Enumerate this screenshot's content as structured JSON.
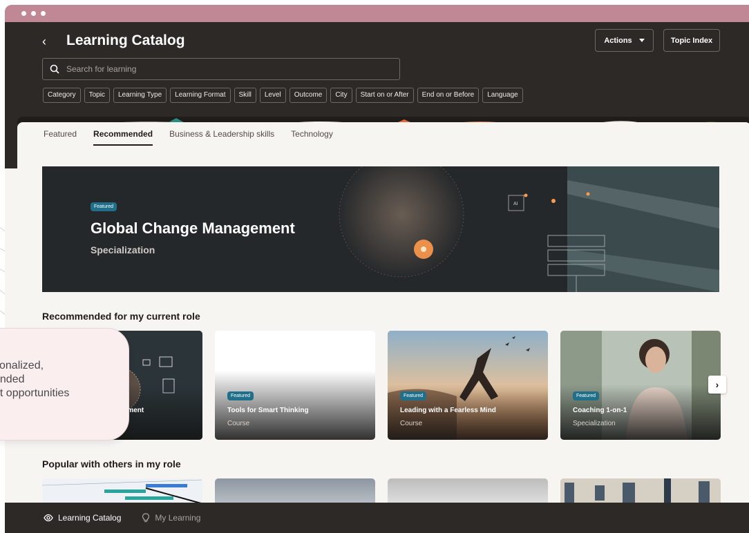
{
  "header": {
    "title": "Learning Catalog",
    "actions_label": "Actions",
    "topic_index_label": "Topic Index"
  },
  "search": {
    "placeholder": "Search for learning"
  },
  "filters": [
    "Category",
    "Topic",
    "Learning Type",
    "Learning Format",
    "Skill",
    "Level",
    "Outcome",
    "City",
    "Start on or After",
    "End on or Before",
    "Language"
  ],
  "tabs": [
    "Featured",
    "Recommended",
    "Business & Leadership skills",
    "Technology"
  ],
  "active_tab": "Recommended",
  "hero": {
    "badge": "Featured",
    "title": "Global Change Management",
    "subtitle": "Specialization"
  },
  "sections": {
    "recommended_title": "Recommended for my current role",
    "popular_title": "Popular with others in my role"
  },
  "recommended_cards": [
    {
      "badge": "",
      "title": "nagement",
      "type": ""
    },
    {
      "badge": "Featured",
      "title": "Tools for Smart Thinking",
      "type": "Course"
    },
    {
      "badge": "Featured",
      "title": "Leading with a Fearless Mind",
      "type": "Course"
    },
    {
      "badge": "Featured",
      "title": "Coaching 1-on-1",
      "type": "Specialization"
    }
  ],
  "callout": {
    "text": "sonalized,\nended\nnt opportunities"
  },
  "footer": {
    "learning_catalog": "Learning Catalog",
    "my_learning": "My Learning"
  },
  "colors": {
    "header_bg": "#2d2927",
    "window_accent": "#c08794",
    "badge_blue": "#1f6f8b"
  }
}
